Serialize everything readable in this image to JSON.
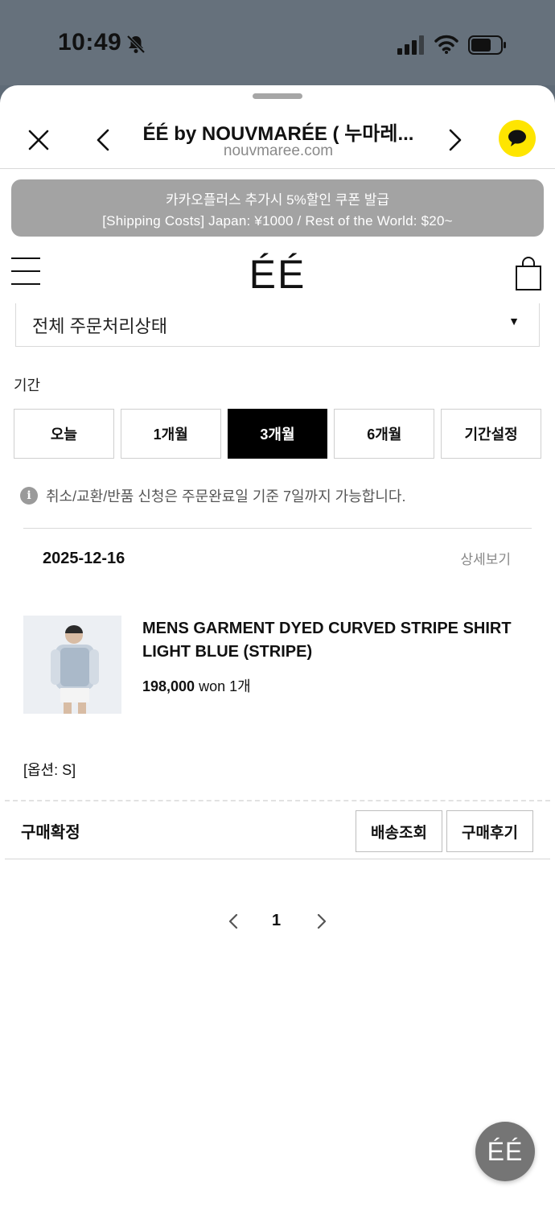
{
  "status_bar": {
    "time": "10:49",
    "icons": [
      "bell-slash-icon",
      "signal-icon",
      "wifi-icon",
      "battery-icon"
    ]
  },
  "browser": {
    "title": "ÉÉ by NOUVMARÉE ( 누마레...",
    "url": "nouvmaree.com",
    "icons": [
      "close-icon",
      "chevron-left-icon",
      "chevron-right-icon",
      "kakao-chat-icon"
    ]
  },
  "promo": {
    "line1": "카카오플러스 추가시 5%할인 쿠폰 발급",
    "line2": "[Shipping Costs] Japan: ¥1000 / Rest of the World: $20~"
  },
  "site_header": {
    "logo": "ÉÉ",
    "icons": [
      "hamburger-menu-icon",
      "shopping-bag-icon"
    ]
  },
  "filters": {
    "status_select": "전체 주문처리상태",
    "period_label": "기간",
    "period_tabs": [
      {
        "label": "오늘",
        "active": false
      },
      {
        "label": "1개월",
        "active": false
      },
      {
        "label": "3개월",
        "active": true
      },
      {
        "label": "6개월",
        "active": false
      },
      {
        "label": "기간설정",
        "active": false
      }
    ],
    "notice": "취소/교환/반품 신청은 주문완료일 기준 7일까지 가능합니다."
  },
  "order": {
    "date": "2025-12-16",
    "detail_link": "상세보기",
    "product_name": "MENS GARMENT DYED CURVED STRIPE SHIRT LIGHT BLUE (STRIPE)",
    "price": "198,000",
    "currency": "won",
    "quantity": "1개",
    "option": "[옵션: S]",
    "status": "구매확정",
    "track_button": "배송조회",
    "review_button": "구매후기"
  },
  "pagination": {
    "current_page": "1"
  },
  "fab": {
    "label": "ÉÉ"
  },
  "colors": {
    "status_bar_bg": "#66717c",
    "promo_bg": "#a3a3a3",
    "kakao_yellow": "#fee500",
    "active_tab": "#000000"
  }
}
